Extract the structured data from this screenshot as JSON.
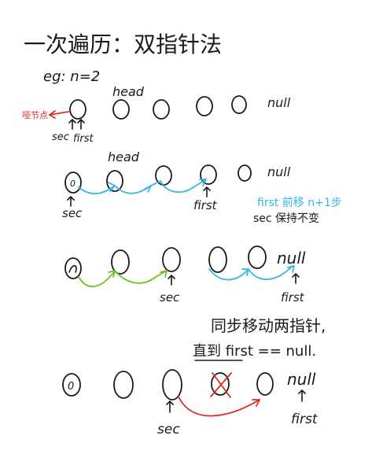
{
  "title": "一次遍历：双指针法",
  "example": "eg: n=2",
  "labels": {
    "head": "head",
    "null": "null",
    "sec": "sec",
    "first": "first",
    "dummy_note": "哑节点",
    "dummy_symbol": "0"
  },
  "notes": {
    "first_move": "first 前移 n+1步",
    "sec_stay": "sec 保持不变",
    "sync_line1": "同步移动两指针,",
    "sync_line2": "直到 first == null."
  },
  "colors": {
    "ink": "#1a1a1a",
    "blue": "#35b6e6",
    "green": "#6cc21e",
    "red": "#e02a2a"
  }
}
